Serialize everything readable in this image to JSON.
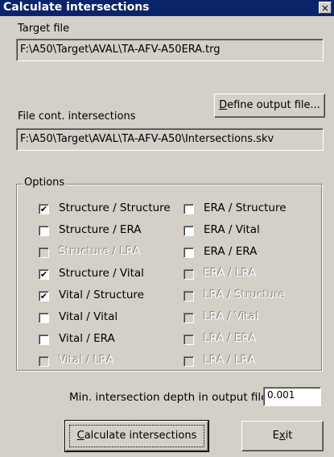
{
  "window": {
    "title": "Calculate intersections",
    "close_label": "×"
  },
  "target_file": {
    "label": "Target file",
    "value": "F:\\A50\\Target\\AVAL\\TA-AFV-A50ERA.trg"
  },
  "output_file": {
    "define_button": "Define output file...",
    "label": "File cont. intersections",
    "value": "F:\\A50\\Target\\AVAL\\TA-AFV-A50\\Intersections.skv"
  },
  "options": {
    "group_label": "Options",
    "left_column": [
      {
        "label": "Structure / Structure",
        "checked": true,
        "enabled": true
      },
      {
        "label": "Structure / ERA",
        "checked": false,
        "enabled": true
      },
      {
        "label": "Structure / LRA",
        "checked": false,
        "enabled": false
      },
      {
        "label": "Structure / Vital",
        "checked": true,
        "enabled": true
      },
      {
        "label": "Vital / Structure",
        "checked": true,
        "enabled": true
      },
      {
        "label": "Vital / Vital",
        "checked": false,
        "enabled": true
      },
      {
        "label": "Vital / ERA",
        "checked": false,
        "enabled": true
      },
      {
        "label": "Vital / LRA",
        "checked": false,
        "enabled": false
      }
    ],
    "right_column": [
      {
        "label": "ERA / Structure",
        "checked": false,
        "enabled": true
      },
      {
        "label": "ERA / Vital",
        "checked": false,
        "enabled": true
      },
      {
        "label": "ERA / ERA",
        "checked": false,
        "enabled": true
      },
      {
        "label": "ERA / LRA",
        "checked": false,
        "enabled": false
      },
      {
        "label": "LRA / Structure",
        "checked": false,
        "enabled": false
      },
      {
        "label": "LRA / Vital",
        "checked": false,
        "enabled": false
      },
      {
        "label": "LRA / ERA",
        "checked": false,
        "enabled": false
      },
      {
        "label": "LRA / LRA",
        "checked": false,
        "enabled": false
      }
    ]
  },
  "depth": {
    "label": "Min. intersection depth in output file",
    "value": "0.001"
  },
  "buttons": {
    "calculate": "Calculate intersections",
    "exit": "Exit"
  },
  "check_glyph": "✔"
}
